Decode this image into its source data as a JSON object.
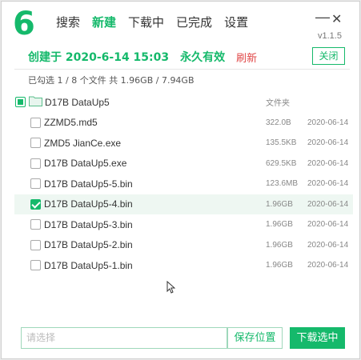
{
  "app": {
    "logo": "6",
    "version": "v1.1.5",
    "brand_color": "#15b96b"
  },
  "nav": {
    "tabs": [
      {
        "label": "搜索",
        "active": false
      },
      {
        "label": "新建",
        "active": true
      },
      {
        "label": "下载中",
        "active": false
      },
      {
        "label": "已完成",
        "active": false
      },
      {
        "label": "设置",
        "active": false
      }
    ]
  },
  "window_controls": {
    "minimize": "—",
    "close": "✕"
  },
  "task": {
    "created": "创建于 2020-6-14 15:03",
    "validity": "永久有效",
    "refresh": "刷新",
    "close_label": "关闭"
  },
  "summary": "已勾选 1 / 8 个文件 共 1.96GB / 7.94GB",
  "files": [
    {
      "name": "D17B DataUp5",
      "size": "文件夹",
      "date": "",
      "state": "partial",
      "is_folder": true
    },
    {
      "name": "ZZMD5.md5",
      "size": "322.0B",
      "date": "2020-06-14",
      "state": "unchecked"
    },
    {
      "name": "ZMD5 JianCe.exe",
      "size": "135.5KB",
      "date": "2020-06-14",
      "state": "unchecked"
    },
    {
      "name": "D17B DataUp5.exe",
      "size": "629.5KB",
      "date": "2020-06-14",
      "state": "unchecked"
    },
    {
      "name": "D17B DataUp5-5.bin",
      "size": "123.6MB",
      "date": "2020-06-14",
      "state": "unchecked"
    },
    {
      "name": "D17B DataUp5-4.bin",
      "size": "1.96GB",
      "date": "2020-06-14",
      "state": "checked"
    },
    {
      "name": "D17B DataUp5-3.bin",
      "size": "1.96GB",
      "date": "2020-06-14",
      "state": "unchecked"
    },
    {
      "name": "D17B DataUp5-2.bin",
      "size": "1.96GB",
      "date": "2020-06-14",
      "state": "unchecked"
    },
    {
      "name": "D17B DataUp5-1.bin",
      "size": "1.96GB",
      "date": "2020-06-14",
      "state": "unchecked"
    }
  ],
  "footer": {
    "path_placeholder": "请选择",
    "save_location": "保存位置",
    "download_selected": "下载选中"
  }
}
